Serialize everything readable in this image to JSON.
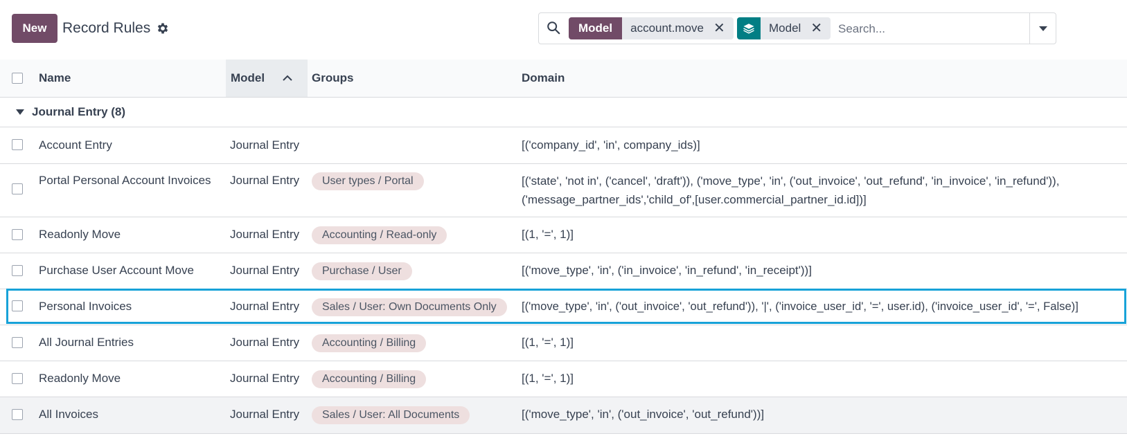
{
  "header": {
    "new_label": "New",
    "title": "Record Rules",
    "settings_icon": "gear-icon"
  },
  "search": {
    "placeholder": "Search...",
    "facets": [
      {
        "label": "Model",
        "value": "account.move"
      },
      {
        "icon": "layers-icon",
        "value": "Model"
      }
    ]
  },
  "table": {
    "columns": {
      "name": "Name",
      "model": "Model",
      "groups": "Groups",
      "domain": "Domain"
    },
    "group": {
      "label": "Journal Entry (8)"
    },
    "rows": [
      {
        "name": "Account Entry",
        "model": "Journal Entry",
        "group": "",
        "domain": [
          "[('company_id', 'in', company_ids)]"
        ]
      },
      {
        "name": "Portal Personal Account Invoices",
        "model": "Journal Entry",
        "group": "User types / Portal",
        "domain": [
          "[('state', 'not in', ('cancel', 'draft')), ('move_type', 'in', ('out_invoice', 'out_refund', 'in_invoice', 'in_refund')),",
          "('message_partner_ids','child_of',[user.commercial_partner_id.id])]"
        ]
      },
      {
        "name": "Readonly Move",
        "model": "Journal Entry",
        "group": "Accounting / Read-only",
        "domain": [
          "[(1, '=', 1)]"
        ]
      },
      {
        "name": "Purchase User Account Move",
        "model": "Journal Entry",
        "group": "Purchase / User",
        "domain": [
          "[('move_type', 'in', ('in_invoice', 'in_refund', 'in_receipt'))]"
        ]
      },
      {
        "name": "Personal Invoices",
        "model": "Journal Entry",
        "group": "Sales / User: Own Documents Only",
        "domain": [
          "[('move_type', 'in', ('out_invoice', 'out_refund')), '|', ('invoice_user_id', '=', user.id), ('invoice_user_id', '=', False)]"
        ]
      },
      {
        "name": "All Journal Entries",
        "model": "Journal Entry",
        "group": "Accounting / Billing",
        "domain": [
          "[(1, '=', 1)]"
        ]
      },
      {
        "name": "Readonly Move",
        "model": "Journal Entry",
        "group": "Accounting / Billing",
        "domain": [
          "[(1, '=', 1)]"
        ]
      },
      {
        "name": "All Invoices",
        "model": "Journal Entry",
        "group": "Sales / User: All Documents",
        "domain": [
          "[('move_type', 'in', ('out_invoice', 'out_refund'))]"
        ]
      }
    ]
  },
  "colors": {
    "brand": "#714b67",
    "teal": "#017e84",
    "link": "#2c7a98",
    "highlight": "#17a2d8",
    "tag": "#eedfdf"
  }
}
